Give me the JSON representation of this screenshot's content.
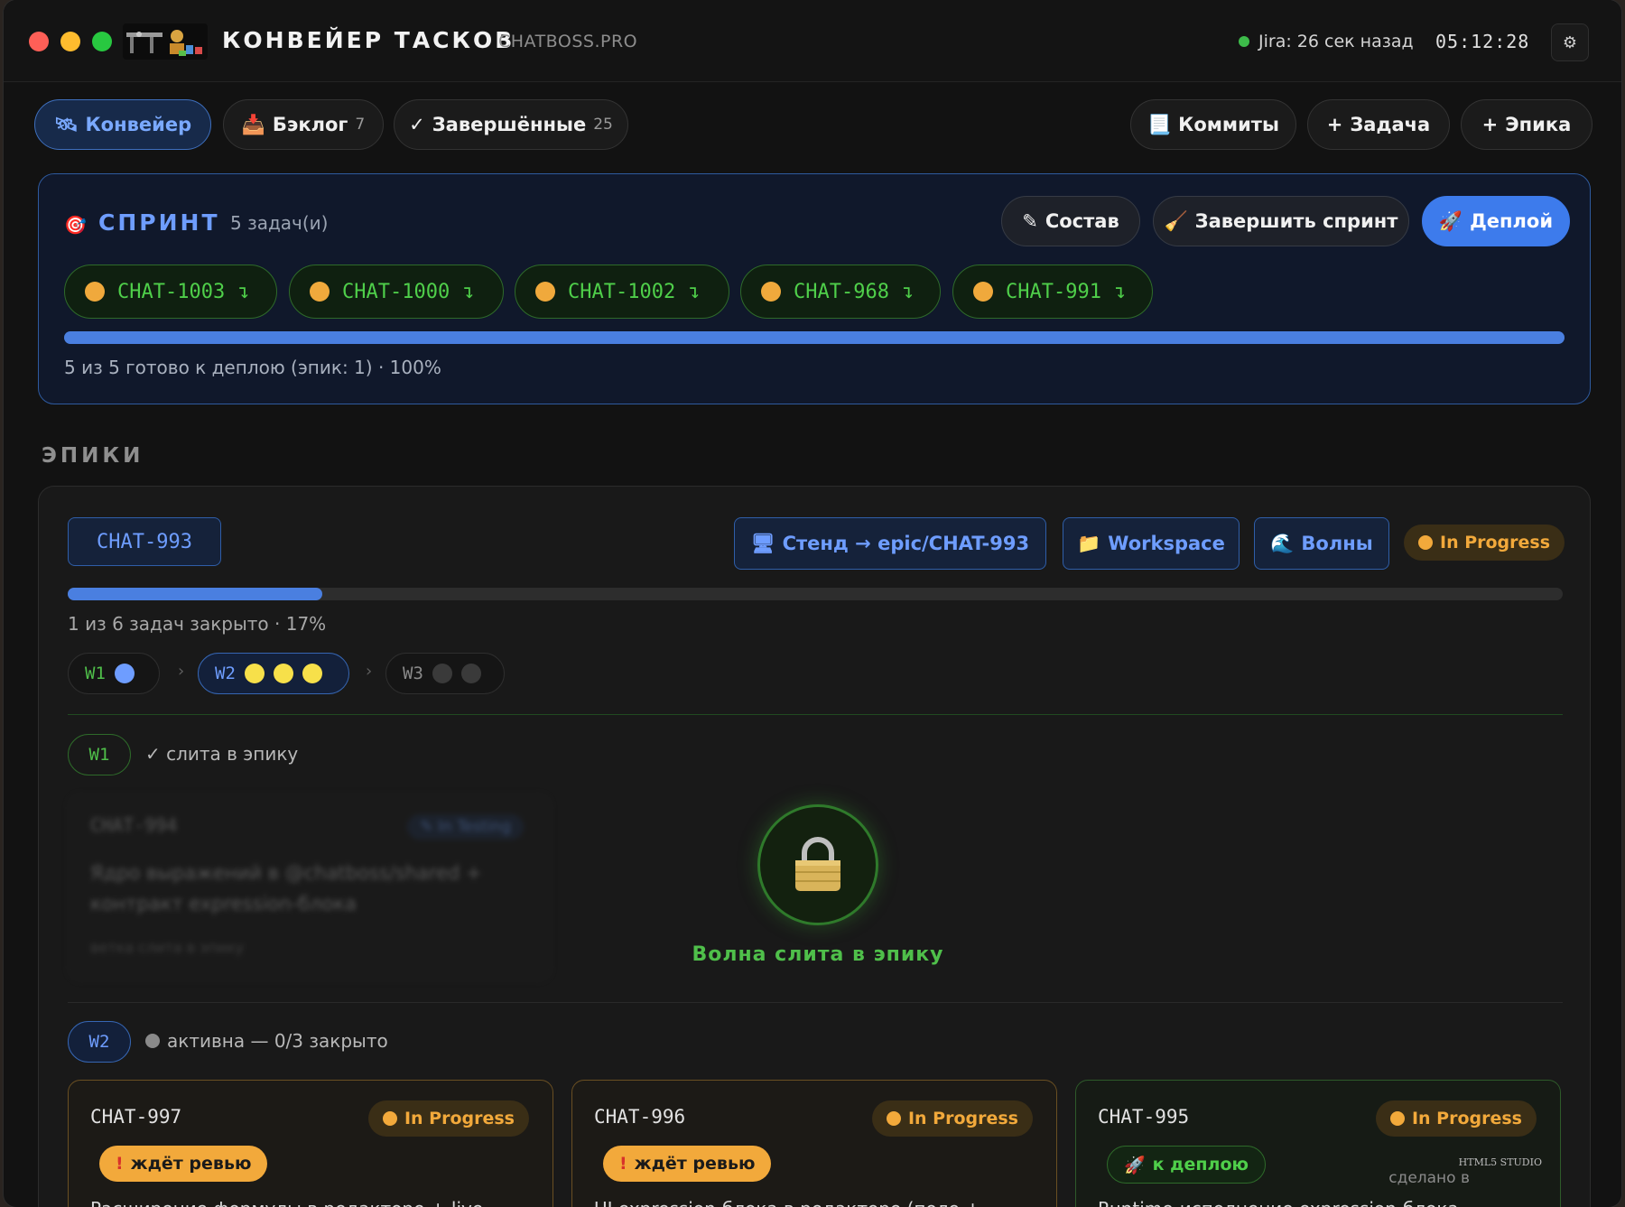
{
  "app": {
    "title": "КОНВЕЙЕР ТАСКОВ",
    "domain": "CHATBOSS.PRO",
    "jira_status": "Jira: 26 сек назад",
    "clock": "05:12:28",
    "settings_icon": "gear-icon"
  },
  "nav": {
    "tabs": [
      {
        "icon": "🛰",
        "label": "Конвейер",
        "count": ""
      },
      {
        "icon": "📥",
        "label": "Бэклог",
        "count": "7"
      },
      {
        "icon": "✓",
        "label": "Завершённые",
        "count": "25"
      }
    ],
    "actions": [
      {
        "icon": "📃",
        "label": "Коммиты"
      },
      {
        "icon": "+",
        "label": "Задача"
      },
      {
        "icon": "+",
        "label": "Эпика"
      }
    ]
  },
  "sprint": {
    "icon": "🎯",
    "title": "СПРИНТ",
    "count": "5 задач(и)",
    "buttons": [
      {
        "icon": "✎",
        "label": "Состав"
      },
      {
        "icon": "🧹",
        "label": "Завершить спринт"
      },
      {
        "icon": "🚀",
        "label": "Деплой"
      }
    ],
    "chips": [
      {
        "key": "CHAT-1003",
        "arrow": "↴"
      },
      {
        "key": "CHAT-1000",
        "arrow": "↴"
      },
      {
        "key": "CHAT-1002",
        "arrow": "↴"
      },
      {
        "key": "CHAT-968",
        "arrow": "↴"
      },
      {
        "key": "CHAT-991",
        "arrow": "↴"
      }
    ],
    "progress_fraction": 1.0,
    "progress_text": "5 из 5 готово к деплою (эпик: 1) · 100%"
  },
  "epics": {
    "heading": "ЭПИКИ",
    "items": [
      {
        "key": "CHAT-993",
        "buttons": [
          {
            "icon": "🖥",
            "label": "Стенд → epic/CHAT-993"
          },
          {
            "icon": "📁",
            "label": "Workspace"
          },
          {
            "icon": "🌊",
            "label": "Волны"
          }
        ],
        "status": "In Progress",
        "progress_fraction": 0.17,
        "progress_text": "1 из 6 задач закрыто · 17%",
        "waves": [
          {
            "label": "W1",
            "dots": 1
          },
          {
            "label": "W2",
            "dots": 3
          },
          {
            "label": "W3",
            "dots": 2
          }
        ],
        "wave_sep": "›",
        "w1": {
          "tag": "W1",
          "status": "✓ слита в эпику",
          "ghost_key": "CHAT-994",
          "ghost_badge": "✎ In Testing",
          "ghost_text": "Ядро выражений в @chatboss/shared + контракт expression-блока",
          "ghost_sub": "ветка слита в эпику",
          "lock_icon": "lock-icon",
          "lock_label": "Волна слита в эпику"
        },
        "w2": {
          "tag": "W2",
          "status": "активна — 0/3 закрыто",
          "tasks": [
            {
              "key": "CHAT-997",
              "status": "In Progress",
              "badge": "ждёт ревью",
              "badge_icon": "!",
              "desc": "Расширение формулы в редакторе + live"
            },
            {
              "key": "CHAT-996",
              "status": "In Progress",
              "badge": "ждёт ревью",
              "badge_icon": "!",
              "desc": "UI expression-блока в редакторе (поле +"
            },
            {
              "key": "CHAT-995",
              "status": "In Progress",
              "badge": "к деплою",
              "badge_icon": "🚀",
              "desc": "Runtime-исполнение expression-блока"
            }
          ]
        }
      }
    ]
  },
  "footer": {
    "made_in": "сделано в",
    "studio": "HTML5 STUDIO"
  },
  "colors": {
    "accent_blue": "#4a7fe0",
    "success_green": "#4fbf4a",
    "warning_amber": "#f2a93b",
    "sprint_border": "#2e5a9e"
  }
}
